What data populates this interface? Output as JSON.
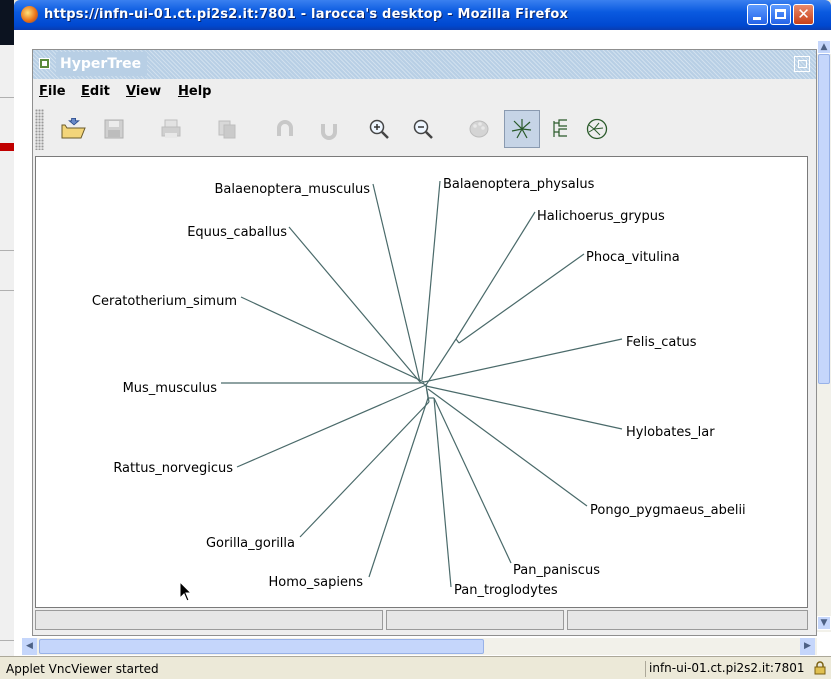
{
  "window": {
    "title": "https://infn-ui-01.ct.pi2s2.it:7801 - larocca's desktop - Mozilla Firefox"
  },
  "applet": {
    "title": "HyperTree",
    "menu": [
      {
        "label": "File",
        "mnemonic": "F",
        "rest": "ile"
      },
      {
        "label": "Edit",
        "mnemonic": "E",
        "rest": "dit"
      },
      {
        "label": "View",
        "mnemonic": "V",
        "rest": "iew"
      },
      {
        "label": "Help",
        "mnemonic": "H",
        "rest": "elp"
      }
    ],
    "toolbar": [
      {
        "icon": "open-folder-icon",
        "enabled": true
      },
      {
        "icon": "save-icon",
        "enabled": false
      },
      {
        "icon": "print-icon",
        "enabled": false
      },
      {
        "icon": "copy-icon",
        "enabled": false
      },
      {
        "icon": "undo-icon",
        "enabled": false
      },
      {
        "icon": "redo-icon",
        "enabled": false
      },
      {
        "icon": "zoom-in-icon",
        "enabled": true
      },
      {
        "icon": "zoom-out-icon",
        "enabled": true
      },
      {
        "icon": "palette-icon",
        "enabled": false
      },
      {
        "icon": "radial-tree-icon",
        "enabled": true,
        "selected": true
      },
      {
        "icon": "tree-layout-icon",
        "enabled": true
      },
      {
        "icon": "hyperbolic-icon",
        "enabled": true
      }
    ],
    "tree_leaves": [
      "Balaenoptera_musculus",
      "Balaenoptera_physalus",
      "Halichoerus_grypus",
      "Phoca_vitulina",
      "Equus_caballus",
      "Ceratotherium_simum",
      "Felis_catus",
      "Mus_musculus",
      "Hylobates_lar",
      "Rattus_norvegicus",
      "Pongo_pygmaeus_abelii",
      "Gorilla_gorilla",
      "Pan_paniscus",
      "Homo_sapiens",
      "Pan_troglodytes"
    ]
  },
  "statusbar": {
    "left": "Applet VncViewer started",
    "right": "infn-ui-01.ct.pi2s2.it:7801"
  }
}
